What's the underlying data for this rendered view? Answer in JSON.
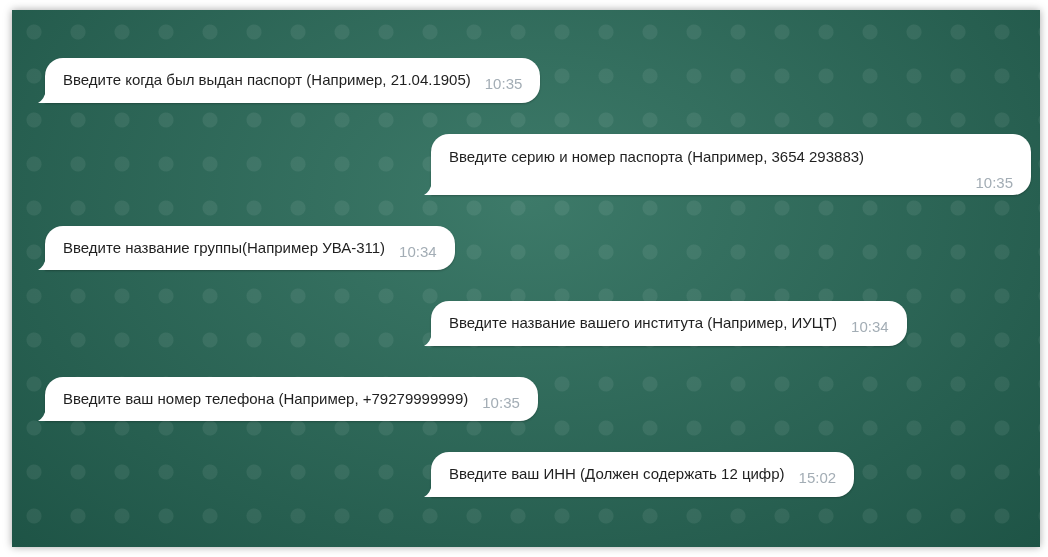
{
  "messages": [
    {
      "kind": "left",
      "text": "Введите когда был выдан паспорт (Например, 21.04.1905)",
      "time": "10:35",
      "time_below": false
    },
    {
      "kind": "right",
      "text": "Введите серию и номер паспорта (Например, 3654 293883)",
      "time": "10:35",
      "time_below": true
    },
    {
      "kind": "left",
      "text": "Введите название группы(Например УВА-311)",
      "time": "10:34",
      "time_below": false
    },
    {
      "kind": "right",
      "text": "Введите название вашего института (Например, ИУЦТ)",
      "time": "10:34",
      "time_below": false
    },
    {
      "kind": "left",
      "text": "Введите ваш номер телефона (Например, +79279999999)",
      "time": "10:35",
      "time_below": false
    },
    {
      "kind": "right",
      "text": "Введите ваш ИНН (Должен содержать 12 цифр)",
      "time": "15:02",
      "time_below": false
    }
  ]
}
